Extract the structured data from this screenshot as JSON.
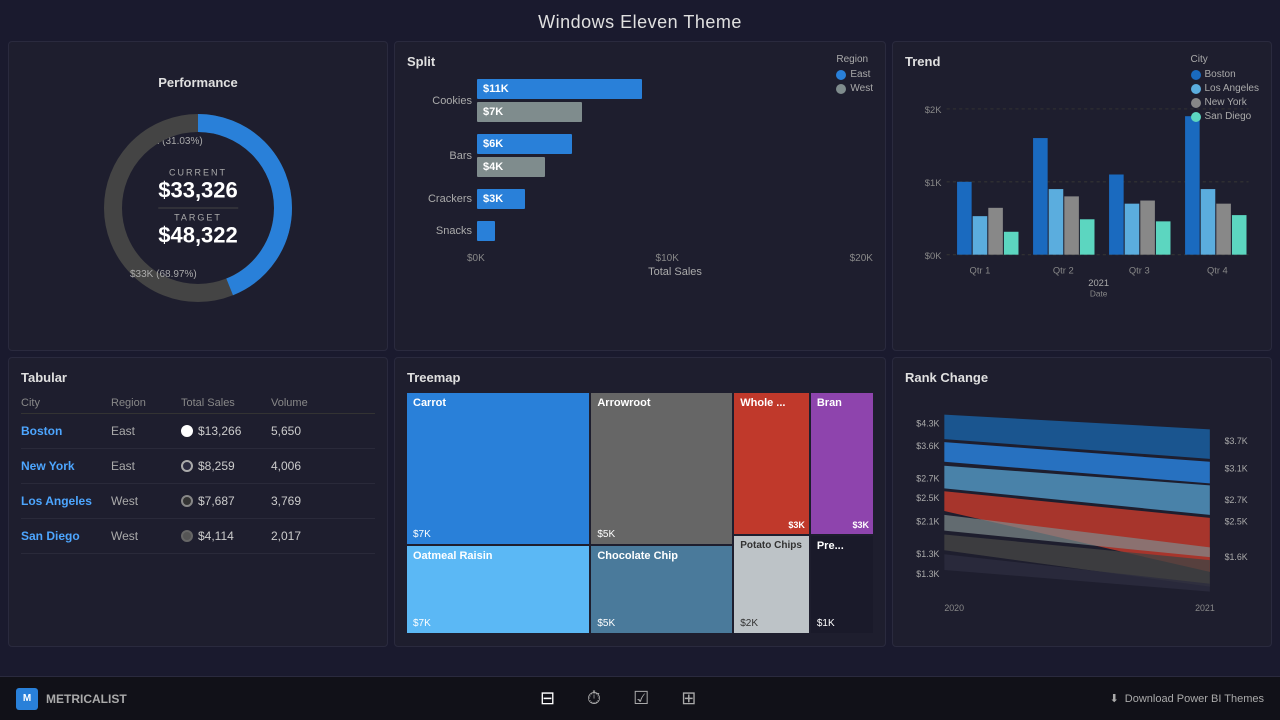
{
  "page": {
    "title": "Windows Eleven Theme"
  },
  "performance": {
    "card_title": "Performance",
    "current_label": "CURRENT",
    "current_value": "$33,326",
    "target_label": "TARGET",
    "target_value": "$48,322",
    "label_top": "$15K (31.03%)",
    "label_bottom": "$33K (68.97%)",
    "percent": 68.97,
    "colors": {
      "filled": "#2980d9",
      "empty": "#444"
    }
  },
  "split": {
    "card_title": "Split",
    "legend": {
      "title": "Region",
      "items": [
        {
          "label": "East",
          "color": "#2980d9"
        },
        {
          "label": "West",
          "color": "#7f8c8d"
        }
      ]
    },
    "rows": [
      {
        "label": "Cookies",
        "east": 11,
        "east_label": "$11K",
        "west": 7,
        "west_label": "$7K"
      },
      {
        "label": "Bars",
        "east": 6,
        "east_label": "$6K",
        "west": 4,
        "west_label": "$4K"
      },
      {
        "label": "Crackers",
        "east": 3,
        "east_label": "$3K",
        "west": 0,
        "west_label": ""
      },
      {
        "label": "Snacks",
        "east": 0.8,
        "east_label": "",
        "west": 0,
        "west_label": ""
      }
    ],
    "x_axis": [
      "$0K",
      "$10K",
      "$20K"
    ],
    "x_label": "Total Sales"
  },
  "trend": {
    "card_title": "Trend",
    "legend": {
      "title": "City",
      "items": [
        {
          "label": "Boston",
          "color": "#1a6abf"
        },
        {
          "label": "Los Angeles",
          "color": "#5badde"
        },
        {
          "label": "New York",
          "color": "#888"
        },
        {
          "label": "San Diego",
          "color": "#5cd6c0"
        }
      ]
    },
    "y_axis": [
      "$2K",
      "$1K",
      "$0K"
    ],
    "x_axis": [
      "Qtr 1",
      "Qtr 2",
      "Qtr 3",
      "Qtr 4"
    ],
    "x_label": "Date",
    "subtitle": "2021"
  },
  "tabular": {
    "card_title": "Tabular",
    "headers": [
      "City",
      "Region",
      "Total Sales",
      "Volume"
    ],
    "rows": [
      {
        "city": "Boston",
        "region": "East",
        "sales": "$13,266",
        "volume": "5,650",
        "dot_color": "#fff",
        "dot_border": "#fff"
      },
      {
        "city": "New York",
        "region": "East",
        "sales": "$8,259",
        "volume": "4,006",
        "dot_color": "#222",
        "dot_border": "#aaa"
      },
      {
        "city": "Los Angeles",
        "region": "West",
        "sales": "$7,687",
        "volume": "3,769",
        "dot_color": "#333",
        "dot_border": "#aaa"
      },
      {
        "city": "San Diego",
        "region": "West",
        "sales": "$4,114",
        "volume": "2,017",
        "dot_color": "#555",
        "dot_border": "#777"
      }
    ]
  },
  "treemap": {
    "card_title": "Treemap",
    "cells": [
      {
        "label": "Carrot",
        "value": "$7K",
        "color": "#2980d9",
        "col": 0,
        "flex": 2
      },
      {
        "label": "Oatmeal Raisin",
        "value": "$7K",
        "color": "#5bb8f5",
        "col": 0,
        "flex": 1
      },
      {
        "label": "Arrowroot",
        "value": "$5K",
        "color": "#666",
        "col": 1,
        "flex": 2
      },
      {
        "label": "Chocolate Chip",
        "value": "$5K",
        "color": "#4a7a9b",
        "col": 1,
        "flex": 1
      },
      {
        "label": "Whole ...",
        "value": "",
        "color": "#c0392b",
        "col": 2,
        "flex": 1
      },
      {
        "label": "Potato Chips",
        "value": "$2K",
        "color": "#bdc3c7",
        "col": 2,
        "flex": 1
      },
      {
        "label": "Bran",
        "value": "$3K",
        "color": "#8e44ad",
        "col": 3,
        "flex": 1
      },
      {
        "label": "Pre...",
        "value": "$1K",
        "color": "#222",
        "col": 3,
        "flex": 1
      }
    ]
  },
  "rank_change": {
    "card_title": "Rank Change",
    "y_left": [
      "$4.3K",
      "$3.6K",
      "$2.7K",
      "$2.5K",
      "$2.1K",
      "$1.3K",
      "$1.3K"
    ],
    "y_right": [
      "$3.7K",
      "$3.1K",
      "$2.7K",
      "$2.5K",
      "$1.6K"
    ],
    "x_labels": [
      "2020",
      "2021"
    ]
  },
  "nav": {
    "brand": "METRICALIST",
    "download_label": "Download Power BI Themes"
  }
}
